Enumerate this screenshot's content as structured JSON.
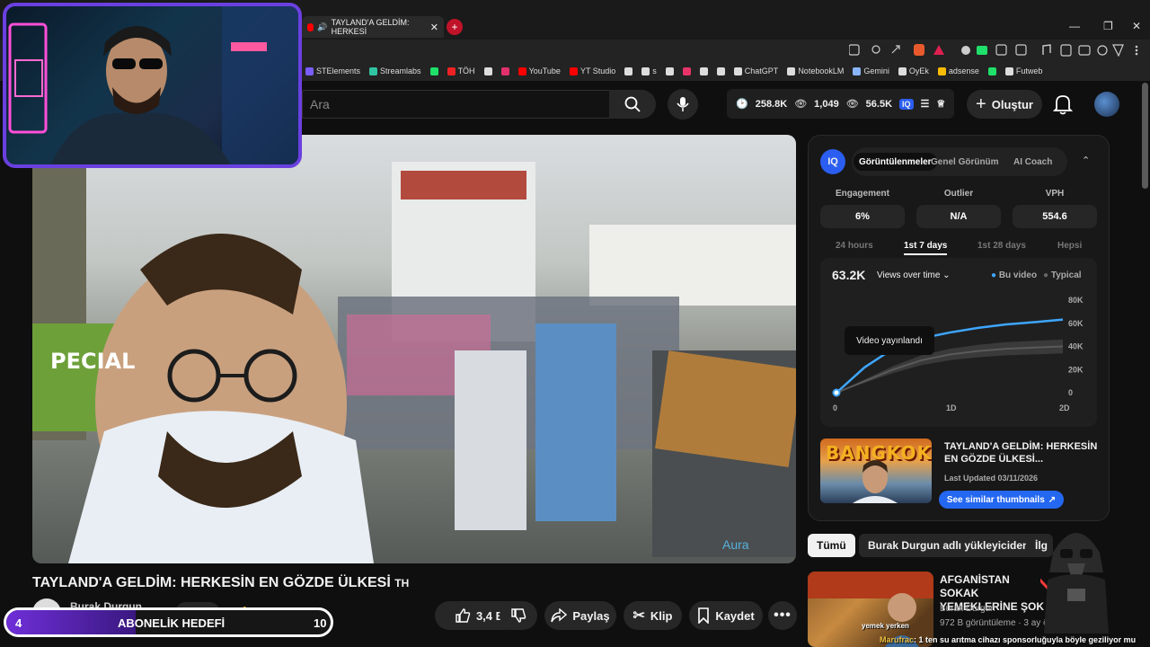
{
  "browser": {
    "tab_title": "TAYLAND'A GELDİM: HERKESİ",
    "bookmarks": [
      {
        "label": "STElements",
        "color": "#7b5cff"
      },
      {
        "label": "Streamlabs",
        "color": "#31c3a2"
      },
      {
        "label": "",
        "color": "#1ee06a"
      },
      {
        "label": "TÖH",
        "color": "#e22"
      },
      {
        "label": "",
        "color": "#ddd"
      },
      {
        "label": "",
        "color": "#e1306c"
      },
      {
        "label": "YouTube",
        "color": "#f00"
      },
      {
        "label": "YT Studio",
        "color": "#f00"
      },
      {
        "label": "",
        "color": "#ddd"
      },
      {
        "label": "s",
        "color": "#ddd"
      },
      {
        "label": "",
        "color": "#ddd"
      },
      {
        "label": "",
        "color": "#e8336a"
      },
      {
        "label": "",
        "color": "#ddd"
      },
      {
        "label": "",
        "color": "#ddd"
      },
      {
        "label": "ChatGPT",
        "color": "#ddd"
      },
      {
        "label": "NotebookLM",
        "color": "#ddd"
      },
      {
        "label": "Gemini",
        "color": "#8ab4f8"
      },
      {
        "label": "OyEk",
        "color": "#ddd"
      },
      {
        "label": "adsense",
        "color": "#fbbc04"
      },
      {
        "label": "",
        "color": "#1ee06a"
      },
      {
        "label": "Futweb",
        "color": "#ddd"
      }
    ]
  },
  "header": {
    "search_placeholder": "Ara",
    "stats": {
      "subs": "258.8K",
      "views_a": "1,049",
      "views_b": "56.5K"
    },
    "create_label": "Oluştur"
  },
  "video": {
    "title": "TAYLAND'A GELDİM: HERKESİN EN GÖZDE ÜLKESİ",
    "title_suffix": "TH",
    "channel": "Burak Durgun",
    "join_label": "Katıl",
    "likes": "3,4 B",
    "share_label": "Paylaş",
    "clip_label": "Klip",
    "save_label": "Kaydet",
    "watermark": "Aura"
  },
  "goal": {
    "current": "4",
    "label": "ABONELİK HEDEFİ",
    "target": "10",
    "fraction": 0.4
  },
  "vidiq": {
    "logo": "IQ",
    "tabs": [
      "Görüntülenmeler",
      "Genel Görünüm",
      "AI Coach"
    ],
    "metrics": [
      {
        "label": "Engagement",
        "value": "6%"
      },
      {
        "label": "Outlier",
        "value": "N/A"
      },
      {
        "label": "VPH",
        "value": "554.6"
      }
    ],
    "ranges": [
      "24 hours",
      "1st 7 days",
      "1st 28 days",
      "Hepsi"
    ],
    "views_total": "63.2K",
    "views_dropdown": "Views over time",
    "legend_this": "Bu video",
    "legend_typical": "Typical",
    "tooltip": "Video yayınlandı",
    "thumb_title": "TAYLAND'A GELDİM: HERKESİN EN GÖZDE ÜLKESİ...",
    "thumb_text": "BANGKOK",
    "last_updated": "Last Updated 03/11/2026",
    "similar_btn": "See similar thumbnails"
  },
  "chart_data": {
    "type": "line",
    "x": [
      0,
      0.25,
      0.5,
      0.75,
      1,
      1.25,
      1.5,
      1.75,
      2
    ],
    "x_ticks": [
      "0",
      "1D",
      "2D"
    ],
    "y_ticks": [
      "0",
      "20K",
      "40K",
      "60K",
      "80K"
    ],
    "ylim": [
      0,
      80000
    ],
    "series": [
      {
        "name": "Bu video",
        "color": "#3ea6ff",
        "values": [
          0,
          22000,
          38000,
          47000,
          52000,
          56000,
          59000,
          61000,
          63200
        ]
      },
      {
        "name": "Typical",
        "color": "#5a5a5a",
        "values": [
          0,
          10000,
          20000,
          28000,
          33000,
          36000,
          38000,
          39000,
          40000
        ]
      }
    ]
  },
  "chips": [
    "Tümü",
    "Burak Durgun adlı yükleyiciden",
    "İlg"
  ],
  "recommendation": {
    "title": "AFGANİSTAN SOKAK YEMEKLERİNE ŞOK",
    "channel": "Burak Durgun",
    "meta": "972 B görüntüleme · 3 ay önce",
    "thumb_caption": "yemek yerken"
  },
  "chat": {
    "user": "Marufrac",
    "message": ": 1 ten su arıtma cihazı sponsorluğuyla böyle geziliyor mu"
  }
}
